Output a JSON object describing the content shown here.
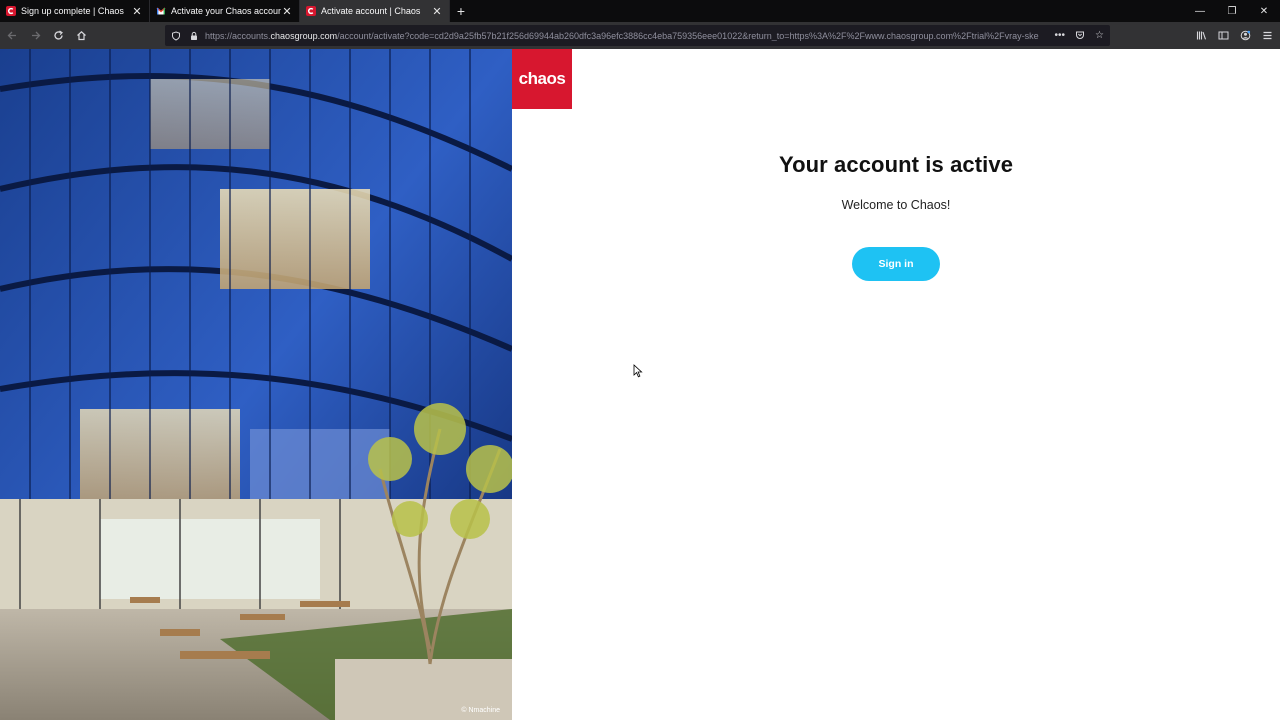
{
  "browser": {
    "tabs": [
      {
        "title": "Sign up complete | Chaos",
        "active": false,
        "favicon": "chaos-favicon"
      },
      {
        "title": "Activate your Chaos account",
        "active": false,
        "favicon": "gmail-favicon"
      },
      {
        "title": "Activate account | Chaos",
        "active": true,
        "favicon": "chaos-favicon"
      }
    ],
    "new_tab_icon": "+",
    "window_controls": {
      "minimize": "—",
      "restore": "❐",
      "close": "✕"
    },
    "url": {
      "prefix": "https://accounts.",
      "host": "chaosgroup.com",
      "path": "/account/activate?code=cd2d9a25fb57b21f256d69944ab260dfc3a96efc3886cc4eba759356eee01022&return_to=https%3A%2F%2Fwww.chaosgroup.com%2Ftrial%2Fvray-ske"
    }
  },
  "page": {
    "logo_text": "chaos",
    "headline": "Your account is active",
    "subline": "Welcome to Chaos!",
    "signin_label": "Sign in",
    "image_credit": "© Nmachine"
  },
  "colors": {
    "brand_red": "#d7172f",
    "button_cyan": "#1ec2f3",
    "tab_strip": "#0c0c0d",
    "toolbar": "#323234"
  }
}
